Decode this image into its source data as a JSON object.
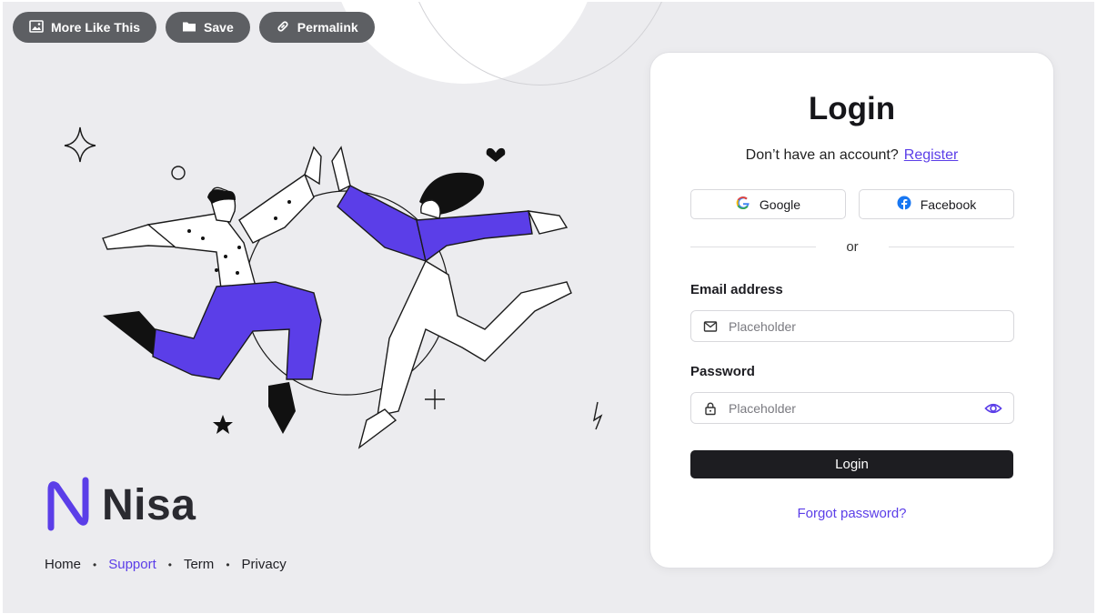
{
  "toolbar": {
    "buttons": [
      {
        "label": "More Like This",
        "icon": "image-icon"
      },
      {
        "label": "Save",
        "icon": "folder-icon"
      },
      {
        "label": "Permalink",
        "icon": "link-icon"
      }
    ]
  },
  "brand": {
    "name": "Nisa",
    "logo_color": "#5b3ee8"
  },
  "footer": {
    "links": [
      {
        "label": "Home",
        "active": false
      },
      {
        "label": "Support",
        "active": true
      },
      {
        "label": "Term",
        "active": false
      },
      {
        "label": "Privacy",
        "active": false
      }
    ],
    "separator": "•"
  },
  "login": {
    "title": "Login",
    "signup_prompt": "Don’t have an account?",
    "register_link": "Register",
    "social": {
      "google_label": "Google",
      "facebook_label": "Facebook"
    },
    "divider": "or",
    "email": {
      "label": "Email address",
      "placeholder": "Placeholder",
      "value": "",
      "icon": "mail-icon"
    },
    "password": {
      "label": "Password",
      "placeholder": "Placeholder",
      "value": "",
      "icon": "lock-icon",
      "toggle_icon": "eye-icon"
    },
    "submit_label": "Login",
    "forgot_label": "Forgot password?"
  },
  "colors": {
    "accent": "#5b3ee8",
    "background": "#ececef",
    "button_dark": "#1d1d21",
    "toolbar_pill": "#5d5f63"
  }
}
